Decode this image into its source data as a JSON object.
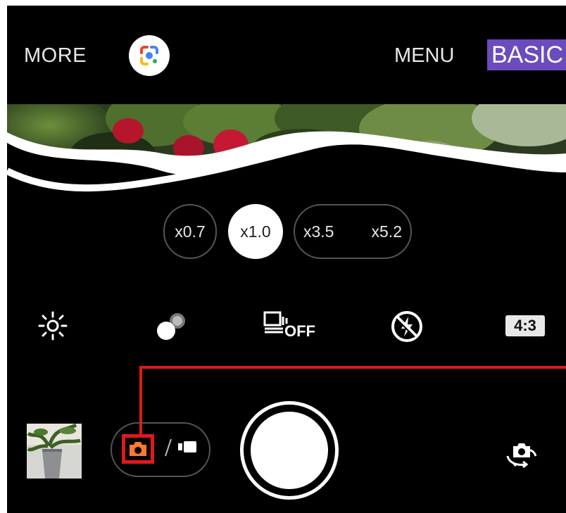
{
  "topbar": {
    "more_label": "MORE",
    "menu_label": "MENU",
    "basic_label": "BASIC"
  },
  "zoom": {
    "options": [
      "x0.7",
      "x1.0",
      "x3.5",
      "x5.2"
    ],
    "selected": "x1.0"
  },
  "settings": {
    "hdr_off_label": "OFF",
    "aspect_ratio": "4:3"
  },
  "colors": {
    "basic_badge": "#6b4bbd",
    "highlight_red": "#e01919",
    "photo_mode_orange": "#ff7a2e"
  },
  "icons": {
    "lens": "google-lens-icon",
    "brightness": "brightness-icon",
    "bokeh": "bokeh-icon",
    "burst": "burst-shooting-icon",
    "flash": "flash-off-icon",
    "photo_mode": "camera-icon",
    "video_mode": "video-icon",
    "flip": "switch-camera-icon"
  }
}
